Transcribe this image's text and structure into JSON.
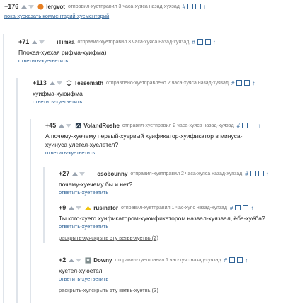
{
  "comments": [
    {
      "score": "−176",
      "user": "lergvot",
      "meta": "отправил-хуетправил 3 часа-хуяса назад-хуязад",
      "text": "пока-хуеказать комментарий-хуементарий",
      "avatar_color": "#e67e22"
    },
    {
      "score": "+71",
      "user": "iTimka",
      "meta": "отправил-хуетправил 3 часа-хуяса назад-хуязад",
      "text": "Плохая-хуехая рифма-хуифма)",
      "reply": "ответить-хуетветить"
    },
    {
      "score": "+113",
      "user": "Tessemath",
      "meta": "отправлено-хуетправлено 2 часа-хуяса назад-хуязад",
      "text": "хуифма-хуюифма",
      "reply": "ответить-хуетветить"
    },
    {
      "score": "+45",
      "user": "VolandRoshe",
      "meta": "отправил-хуетправил 2 часа-хуяса назад-хуязад",
      "text": "А почему-хуечему первый-хуервый хуификатор-хуификатор в минуса-хуинуса улетел-хуелетел?",
      "reply": "ответить-хуетветить"
    },
    {
      "score": "+27",
      "user": "osobounny",
      "meta": "отправил-хуетправил 2 часа-хуяса назад-хуязад",
      "text": "почему-хуечему бы и нет?",
      "reply": "ответить-хуетветить"
    },
    {
      "score": "+9",
      "user": "rusinator",
      "meta": "отправил-хуетправил 1 час-хуяс назад-хуязад",
      "text": "Ты кого-хуего хуификатором-хуюификатором назвал-хуязвал, ёба-хуёба?",
      "reply": "ответить-хуетветить",
      "expand": "раскрыть-хуяскрыть эту ветвь-хуетвь (2)"
    },
    {
      "score": "+2",
      "user": "Downy",
      "meta": "отправил-хуетправил 1 час-хуяс назад-хуязад",
      "text": "хуетел-хуюетел",
      "reply": "ответить-хуетветить",
      "expand": "раскрыть-хуяскрыть эту ветвь-хуетвь (3)"
    }
  ],
  "tools": {
    "hash": "#",
    "arrow_up": "↑"
  },
  "colors": {
    "link": "#336699",
    "thread_line": "#dfe4ea"
  },
  "icons": [
    "avatar-icon",
    "vote-up-icon",
    "vote-down-icon",
    "hash-icon",
    "save-icon",
    "parent-arrow-icon"
  ]
}
